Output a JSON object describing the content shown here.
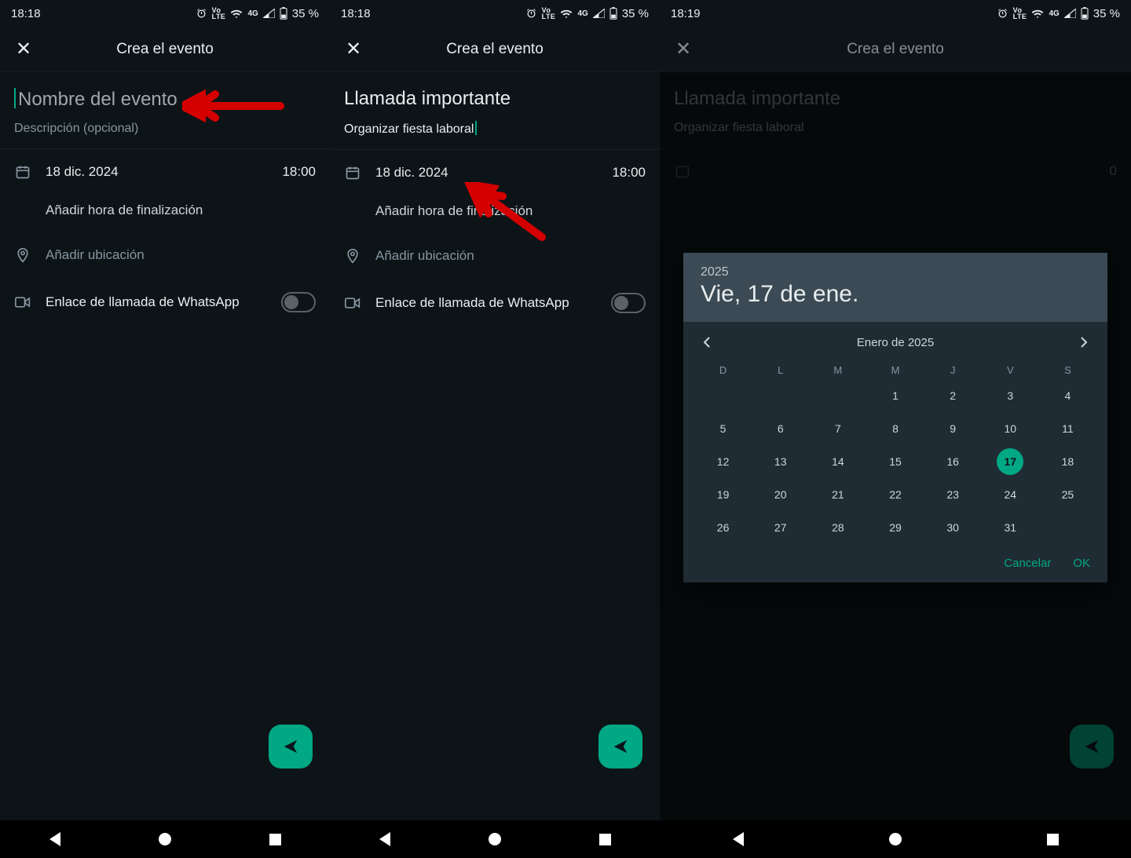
{
  "status": {
    "time1": "18:18",
    "time2": "18:18",
    "time3": "18:19",
    "battery": "35 %"
  },
  "header": {
    "title": "Crea el evento"
  },
  "screen1": {
    "name_placeholder": "Nombre del evento",
    "desc_placeholder": "Descripción (opcional)",
    "date": "18 dic. 2024",
    "time": "18:00",
    "add_end": "Añadir hora de finalización",
    "add_loc": "Añadir ubicación",
    "call_link": "Enlace de llamada de WhatsApp"
  },
  "screen2": {
    "name": "Llamada importante",
    "desc": "Organizar fiesta laboral",
    "date": "18 dic. 2024",
    "time": "18:00",
    "add_end": "Añadir hora de finalización",
    "add_loc": "Añadir ubicación",
    "call_link": "Enlace de llamada de WhatsApp"
  },
  "screen3": {
    "name": "Llamada importante",
    "desc": "Organizar fiesta laboral",
    "time": "0"
  },
  "picker": {
    "year": "2025",
    "header_date": "Vie, 17 de ene.",
    "month_label": "Enero de 2025",
    "dow": [
      "D",
      "L",
      "M",
      "M",
      "J",
      "V",
      "S"
    ],
    "lead_blanks": 3,
    "days": 31,
    "selected": 17,
    "cancel": "Cancelar",
    "ok": "OK"
  },
  "fab_glyph": ">"
}
